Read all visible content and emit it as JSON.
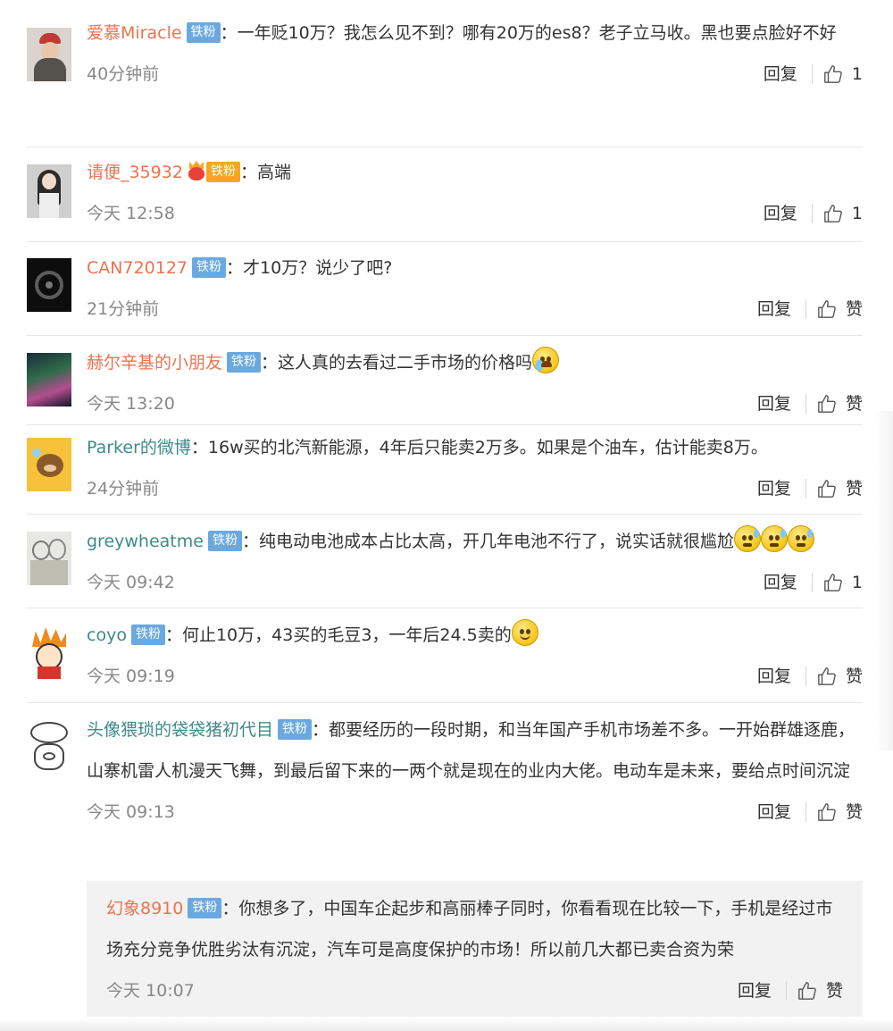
{
  "comments": [
    {
      "user": "爱慕Miracle",
      "badge": "铁粉",
      "sep": "：",
      "text": "一年贬10万？我怎么见不到？哪有20万的es8？老子立马收。黑也要点脸好不好",
      "time": "40分钟前",
      "reply": "回复",
      "like": "1"
    },
    {
      "user": "请便_35932",
      "badge": "铁粉",
      "sep": "：",
      "text": "高端",
      "time": "今天 12:58",
      "reply": "回复",
      "like": "1"
    },
    {
      "user": "CAN720127",
      "badge": "铁粉",
      "sep": "：",
      "text": "才10万？说少了吧?",
      "time": "21分钟前",
      "reply": "回复",
      "like": "赞"
    },
    {
      "user": "赫尔辛基的小朋友",
      "badge": "铁粉",
      "sep": "：",
      "text": "这人真的去看过二手市场的价格吗",
      "time": "今天 13:20",
      "reply": "回复",
      "like": "赞"
    },
    {
      "user": "Parker的微博",
      "sep": "：",
      "text": "16w买的北汽新能源，4年后只能卖2万多。如果是个油车，估计能卖8万。",
      "time": "24分钟前",
      "reply": "回复",
      "like": "赞"
    },
    {
      "user": "greywheatme",
      "badge": "铁粉",
      "sep": "：",
      "text": "纯电动电池成本占比太高，开几年电池不行了，说实话就很尴尬",
      "time": "今天 09:42",
      "reply": "回复",
      "like": "1"
    },
    {
      "user": "coyo",
      "badge": "铁粉",
      "sep": "：",
      "text": "何止10万，43买的毛豆3，一年后24.5卖的",
      "time": "今天 09:19",
      "reply": "回复",
      "like": "赞"
    },
    {
      "user": "头像猥琐的袋袋猪初代目",
      "badge": "铁粉",
      "sep": "：",
      "text": "都要经历的一段时期，和当年国产手机市场差不多。一开始群雄逐鹿，山寨机雷人机漫天飞舞，到最后留下来的一两个就是现在的业内大佬。电动车是未来，要给点时间沉淀",
      "time": "今天 09:13",
      "reply": "回复",
      "like": "赞"
    }
  ],
  "subreply": {
    "user": "幻象8910",
    "badge": "铁粉",
    "sep": "：",
    "text": "你想多了，中国车企起步和高丽棒子同时，你看看现在比较一下，手机是经过市场充分竞争优胜劣汰有沉淀，汽车可是高度保护的市场！所以前几大都已卖合资为荣",
    "time": "今天 10:07",
    "reply": "回复",
    "like": "赞"
  },
  "avatars": [
    "avatar-girl-red-hat",
    "avatar-girl-portrait",
    "avatar-steering-wheel",
    "avatar-aurora",
    "avatar-brown-bear",
    "avatar-sketch-couple",
    "avatar-cartoon-spiky-hair",
    "avatar-pig-doodle"
  ],
  "colors": {
    "username": "#eb7350",
    "username_alt": "#3e8a8a",
    "badge": "#6aa9e0",
    "meta": "#888888",
    "divider": "#e6e6e6",
    "subreply_bg": "#f2f2f2"
  }
}
